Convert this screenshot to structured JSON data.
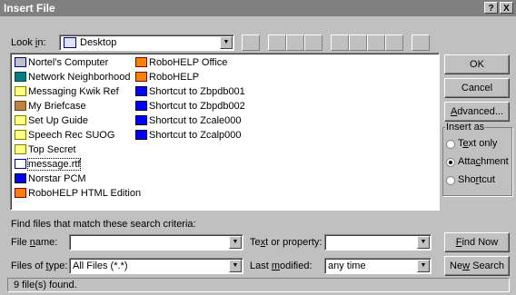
{
  "dialog": {
    "title": "Insert File",
    "help_btn": "?",
    "close_btn": "X"
  },
  "look_in": {
    "label": "Look in:",
    "value": "Desktop"
  },
  "files": [
    {
      "name": "Nortel's Computer",
      "icon": "computer-icon"
    },
    {
      "name": "Network Neighborhood",
      "icon": "network-icon"
    },
    {
      "name": "Messaging Kwik Ref",
      "icon": "folder-icon"
    },
    {
      "name": "My Briefcase",
      "icon": "briefcase-icon"
    },
    {
      "name": "Set Up Guide",
      "icon": "folder-icon"
    },
    {
      "name": "Speech Rec SUOG",
      "icon": "folder-icon"
    },
    {
      "name": "Top Secret",
      "icon": "folder-icon"
    },
    {
      "name": "message.rtf",
      "icon": "document-icon"
    },
    {
      "name": "Norstar PCM",
      "icon": "application-icon"
    },
    {
      "name": "RoboHELP HTML Edition",
      "icon": "robohelp-icon"
    },
    {
      "name": "RoboHELP Office",
      "icon": "robohelp-icon"
    },
    {
      "name": "RoboHELP",
      "icon": "robohelp-icon"
    },
    {
      "name": "Shortcut to Zbpdb001",
      "icon": "shortcut-icon"
    },
    {
      "name": "Shortcut to Zbpdb002",
      "icon": "shortcut-icon"
    },
    {
      "name": "Shortcut to Zcale000",
      "icon": "shortcut-icon"
    },
    {
      "name": "Shortcut to Zcalp000",
      "icon": "shortcut-icon"
    }
  ],
  "buttons": {
    "ok": "OK",
    "cancel": "Cancel",
    "advanced": "Advanced...",
    "find_now": "Find Now",
    "new_search": "New Search"
  },
  "insert_as": {
    "label": "Insert as",
    "options": [
      "Text only",
      "Attachment",
      "Shortcut"
    ],
    "selected": "Attachment"
  },
  "search": {
    "criteria_label": "Find files that match these search criteria:",
    "file_name_label": "File name:",
    "file_name_value": "",
    "files_of_type_label": "Files of type:",
    "files_of_type_value": "All Files (*.*)",
    "text_property_label": "Text or property:",
    "text_property_value": "",
    "last_modified_label": "Last modified:",
    "last_modified_value": "any time"
  },
  "status": "9 file(s) found."
}
